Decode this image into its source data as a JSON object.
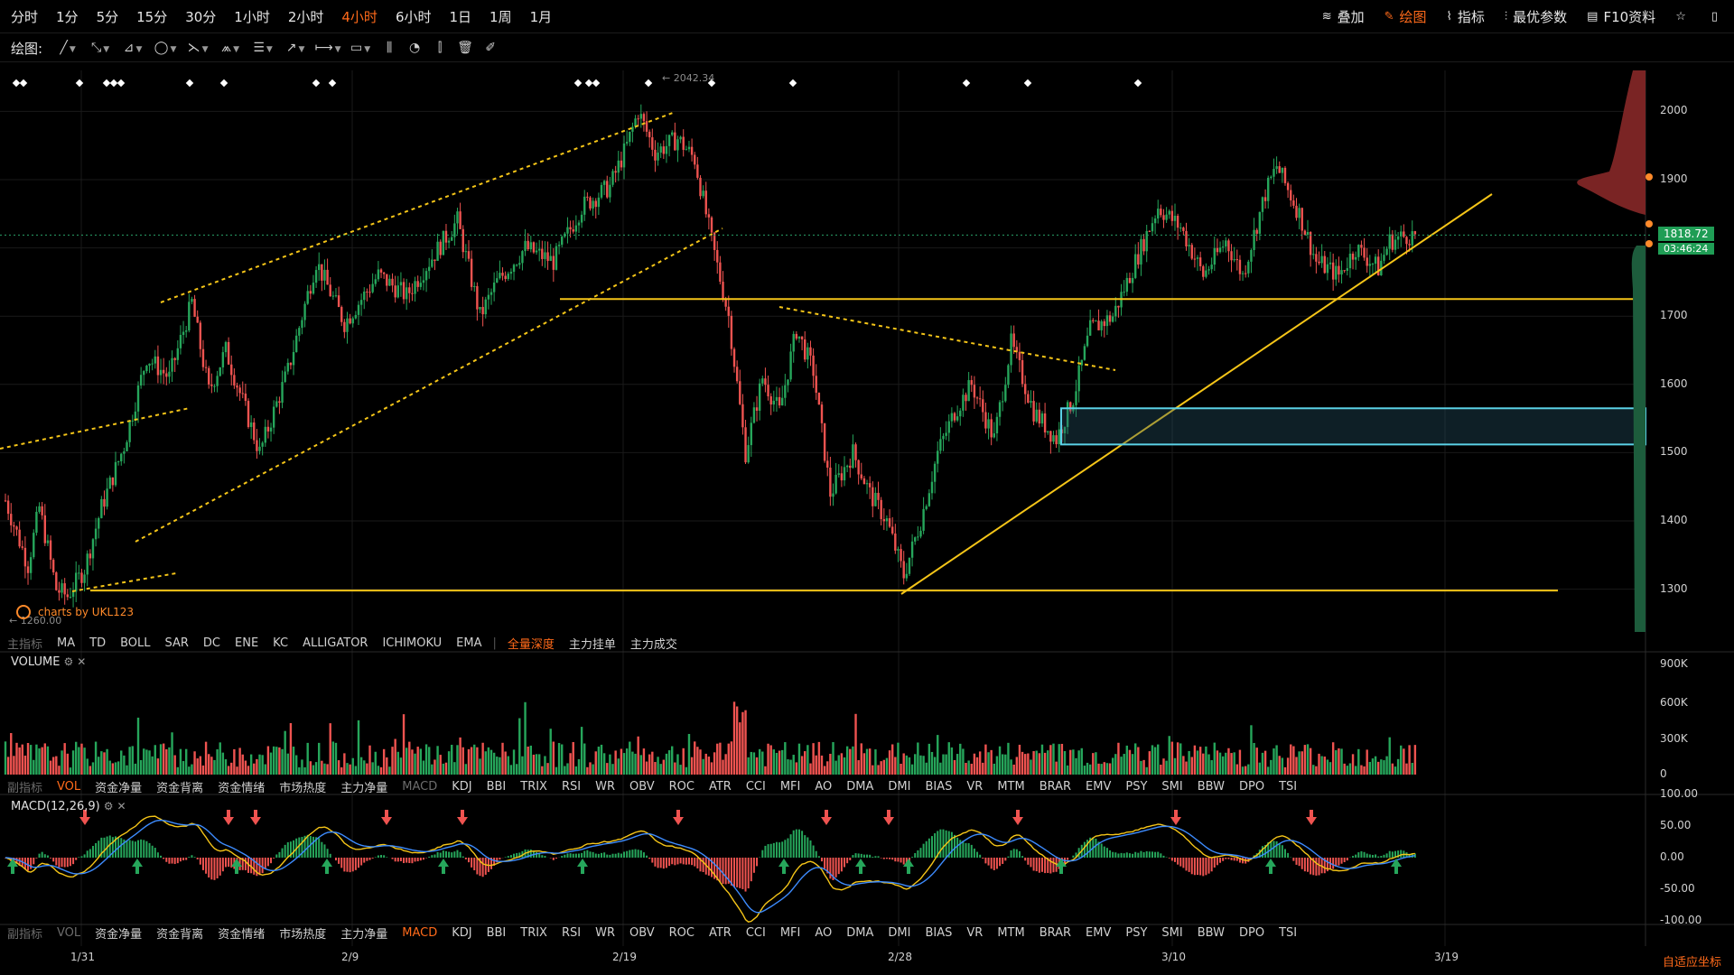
{
  "toolbar": {
    "timeframes": [
      "分时",
      "1分",
      "5分",
      "15分",
      "30分",
      "1小时",
      "2小时",
      "4小时",
      "6小时",
      "1日",
      "1周",
      "1月"
    ],
    "active_timeframe": "4小时",
    "right_buttons": [
      {
        "label": "叠加",
        "icon": "layers-icon",
        "glyph": "≋",
        "active": false
      },
      {
        "label": "绘图",
        "icon": "pen-icon",
        "glyph": "✎",
        "active": true
      },
      {
        "label": "指标",
        "icon": "indicator-icon",
        "glyph": "⌇",
        "active": false
      },
      {
        "label": "最优参数",
        "icon": "params-icon",
        "glyph": "⫶",
        "active": false
      },
      {
        "label": "F10资料",
        "icon": "document-icon",
        "glyph": "▤",
        "active": false
      },
      {
        "label": "",
        "icon": "star-icon",
        "glyph": "☆",
        "active": false
      },
      {
        "label": "",
        "icon": "layout-icon",
        "glyph": "▯",
        "active": false
      }
    ]
  },
  "drawbar": {
    "label": "绘图:",
    "tools": [
      {
        "icon": "line-tool-icon",
        "glyph": "╱",
        "dd": true
      },
      {
        "icon": "trend-tool-icon",
        "glyph": "⤡",
        "dd": true
      },
      {
        "icon": "polyline-tool-icon",
        "glyph": "⊿",
        "dd": true
      },
      {
        "icon": "circle-tool-icon",
        "glyph": "◯",
        "dd": true
      },
      {
        "icon": "fib-tool-icon",
        "glyph": "⋋",
        "dd": true
      },
      {
        "icon": "pattern-tool-icon",
        "glyph": "⩕",
        "dd": true
      },
      {
        "icon": "gann-tool-icon",
        "glyph": "☰",
        "dd": true
      },
      {
        "icon": "arrow-tool-icon",
        "glyph": "↗",
        "dd": true
      },
      {
        "icon": "measure-tool-icon",
        "glyph": "⟼",
        "dd": true
      },
      {
        "icon": "comment-tool-icon",
        "glyph": "▭",
        "dd": true
      },
      {
        "icon": "candle-tool-icon",
        "glyph": "⫼",
        "dd": false
      },
      {
        "icon": "chart-tool-icon",
        "glyph": "◔",
        "dd": false
      },
      {
        "icon": "bar-tool-icon",
        "glyph": "⫿",
        "dd": false
      },
      {
        "icon": "trash-icon",
        "glyph": "🗑",
        "dd": false
      },
      {
        "icon": "erase-icon",
        "glyph": "✐",
        "dd": false
      }
    ]
  },
  "main_indicators": {
    "label": "主指标",
    "items": [
      "MA",
      "TD",
      "BOLL",
      "SAR",
      "DC",
      "ENE",
      "KC",
      "ALLIGATOR",
      "ICHIMOKU",
      "EMA"
    ],
    "extra": [
      "全量深度",
      "主力挂单",
      "主力成交"
    ],
    "active_extra": "全量深度"
  },
  "sub_indicators": {
    "label": "副指标",
    "items": [
      "VOL",
      "资金净量",
      "资金背离",
      "资金情绪",
      "市场热度",
      "主力净量",
      "MACD",
      "KDJ",
      "BBI",
      "TRIX",
      "RSI",
      "WR",
      "OBV",
      "ROC",
      "ATR",
      "CCI",
      "MFI",
      "AO",
      "DMA",
      "DMI",
      "BIAS",
      "VR",
      "MTM",
      "BRAR",
      "EMV",
      "PSY",
      "SMI",
      "BBW",
      "DPO",
      "TSI"
    ]
  },
  "volume_panel": {
    "title": "VOLUME",
    "active": "VOL"
  },
  "macd_panel": {
    "title": "MACD(12,26,9)",
    "active": "MACD"
  },
  "price_axis": {
    "ticks": [
      "2000",
      "1900",
      "1800",
      "1700",
      "1600",
      "1500",
      "1400",
      "1300"
    ]
  },
  "volume_axis": {
    "ticks": [
      "900K",
      "600K",
      "300K",
      "0"
    ]
  },
  "macd_axis": {
    "ticks": [
      "100.00",
      "50.00",
      "0.00",
      "-50.00",
      "-100.00"
    ]
  },
  "x_axis": {
    "ticks": [
      "1/31",
      "2/9",
      "2/19",
      "2/28",
      "3/10",
      "3/19"
    ]
  },
  "current_price": "1818.72",
  "countdown": "03:46:24",
  "high_label": "← 2042.34",
  "low_label": "← 1260.00",
  "watermark": "charts by UKL123",
  "auto_scale_label": "自适应坐标",
  "colors": {
    "up": "#26a65b",
    "down": "#ef5350",
    "accent": "#ff6a1a",
    "yellow": "#f5c518",
    "cyan": "#5ad1e6",
    "dif": "#f5c518",
    "dea": "#3d8bfd"
  },
  "chart_data": {
    "type": "candlestick",
    "ylim": [
      1240,
      2060
    ],
    "x_ticks": [
      "1/31",
      "2/9",
      "2/19",
      "2/28",
      "3/10",
      "3/19"
    ],
    "current_price": 1818.72,
    "high": 2042.34,
    "low": 1260.0,
    "waypoints": [
      [
        0,
        1430
      ],
      [
        8,
        1335
      ],
      [
        12,
        1420
      ],
      [
        18,
        1300
      ],
      [
        22,
        1290
      ],
      [
        28,
        1330
      ],
      [
        34,
        1420
      ],
      [
        42,
        1510
      ],
      [
        50,
        1640
      ],
      [
        58,
        1610
      ],
      [
        66,
        1720
      ],
      [
        72,
        1590
      ],
      [
        78,
        1650
      ],
      [
        90,
        1500
      ],
      [
        100,
        1620
      ],
      [
        110,
        1780
      ],
      [
        120,
        1690
      ],
      [
        132,
        1760
      ],
      [
        142,
        1730
      ],
      [
        150,
        1780
      ],
      [
        160,
        1840
      ],
      [
        168,
        1700
      ],
      [
        174,
        1750
      ],
      [
        184,
        1800
      ],
      [
        194,
        1780
      ],
      [
        204,
        1860
      ],
      [
        214,
        1890
      ],
      [
        220,
        1950
      ],
      [
        224,
        2000
      ],
      [
        230,
        1940
      ],
      [
        238,
        1960
      ],
      [
        244,
        1930
      ],
      [
        250,
        1810
      ],
      [
        256,
        1700
      ],
      [
        262,
        1500
      ],
      [
        268,
        1610
      ],
      [
        274,
        1560
      ],
      [
        280,
        1680
      ],
      [
        286,
        1620
      ],
      [
        292,
        1440
      ],
      [
        300,
        1500
      ],
      [
        306,
        1440
      ],
      [
        312,
        1400
      ],
      [
        318,
        1320
      ],
      [
        324,
        1400
      ],
      [
        330,
        1500
      ],
      [
        336,
        1560
      ],
      [
        342,
        1600
      ],
      [
        350,
        1520
      ],
      [
        356,
        1660
      ],
      [
        364,
        1560
      ],
      [
        372,
        1520
      ],
      [
        378,
        1580
      ],
      [
        384,
        1680
      ],
      [
        392,
        1700
      ],
      [
        400,
        1780
      ],
      [
        408,
        1860
      ],
      [
        416,
        1830
      ],
      [
        424,
        1760
      ],
      [
        432,
        1810
      ],
      [
        438,
        1760
      ],
      [
        446,
        1880
      ],
      [
        450,
        1920
      ],
      [
        458,
        1850
      ],
      [
        464,
        1780
      ],
      [
        472,
        1760
      ],
      [
        478,
        1800
      ],
      [
        486,
        1770
      ],
      [
        490,
        1810
      ],
      [
        496,
        1818
      ]
    ],
    "horizontal_lines": [
      1725,
      1298
    ],
    "zone": [
      1512,
      1565
    ],
    "volume_unit": "K",
    "volume_ylim": [
      0,
      900
    ],
    "macd_ylim": [
      -100,
      100
    ]
  }
}
